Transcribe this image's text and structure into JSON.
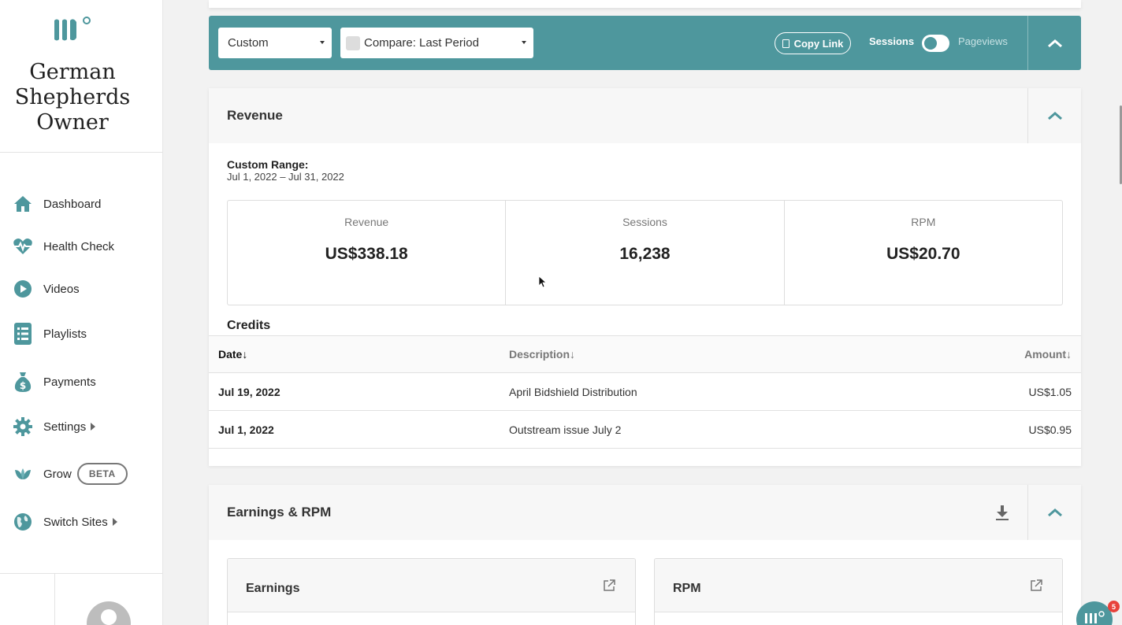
{
  "sidebar": {
    "site_title": "German Shepherds Owner",
    "items": [
      {
        "label": "Dashboard",
        "icon": "home-icon"
      },
      {
        "label": "Health Check",
        "icon": "heartbeat-icon"
      },
      {
        "label": "Videos",
        "icon": "play-icon"
      },
      {
        "label": "Playlists",
        "icon": "list-icon"
      },
      {
        "label": "Payments",
        "icon": "money-bag-icon"
      },
      {
        "label": "Settings",
        "icon": "gear-icon"
      },
      {
        "label": "Grow",
        "icon": "leaf-icon",
        "badge": "BETA"
      },
      {
        "label": "Switch Sites",
        "icon": "globe-icon"
      }
    ]
  },
  "filters": {
    "date_range": "Custom",
    "compare": "Compare: Last Period",
    "copy_link": "Copy Link",
    "toggle_left": "Sessions",
    "toggle_right": "Pageviews"
  },
  "revenue": {
    "title": "Revenue",
    "range_label": "Custom Range:",
    "range_value": "Jul 1, 2022 – Jul 31, 2022",
    "stats": [
      {
        "label": "Revenue",
        "value": "US$338.18"
      },
      {
        "label": "Sessions",
        "value": "16,238"
      },
      {
        "label": "RPM",
        "value": "US$20.70"
      }
    ]
  },
  "credits": {
    "title": "Credits",
    "columns": [
      "Date↓",
      "Description↓",
      "Amount↓"
    ],
    "rows": [
      {
        "date": "Jul 19, 2022",
        "description": "April Bidshield Distribution",
        "amount": "US$1.05"
      },
      {
        "date": "Jul 1, 2022",
        "description": "Outstream issue July 2",
        "amount": "US$0.95"
      }
    ]
  },
  "earnings_rpm": {
    "title": "Earnings & RPM",
    "sub_cards": [
      "Earnings",
      "RPM"
    ]
  },
  "chat": {
    "badge_count": "5"
  },
  "colors": {
    "accent": "#4e979d",
    "badge": "#e8423b"
  }
}
